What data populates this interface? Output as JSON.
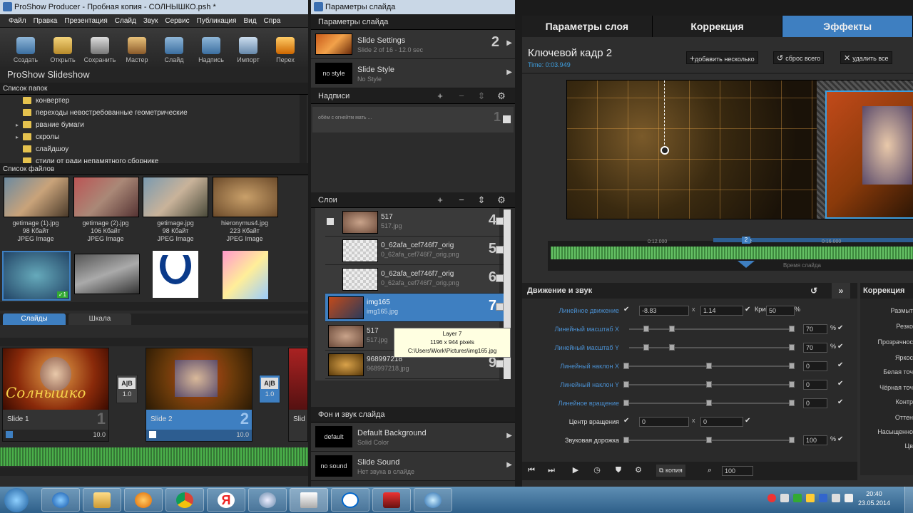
{
  "left_window": {
    "title": "ProShow Producer - Пробная копия - СОЛНЫШКО.psh *",
    "menu": [
      "Файл",
      "Правка",
      "Презентация",
      "Слайд",
      "Звук",
      "Сервис",
      "Публикация",
      "Вид",
      "Спра"
    ],
    "toolbar": [
      "Создать",
      "Открыть",
      "Сохранить",
      "Мастер",
      "Слайд",
      "Надпись",
      "Импорт",
      "Перех"
    ],
    "app_label": "ProShow Slideshow",
    "folders_title": "Список папок",
    "folders": [
      "конвертер",
      "переходы невостребованные  геометрические",
      "рвание бумаги",
      "скролы",
      "слайдшоу",
      "стили от ради непамятного сборнике"
    ],
    "files_title": "Список файлов",
    "files": [
      {
        "name": "getimage (1).jpg",
        "size": "98 Кбайт",
        "type": "JPEG Image"
      },
      {
        "name": "getimage (2).jpg",
        "size": "106 Кбайт",
        "type": "JPEG Image"
      },
      {
        "name": "getimage.jpg",
        "size": "98 Кбайт",
        "type": "JPEG Image"
      },
      {
        "name": "hieronymus4.jpg",
        "size": "223 Кбайт",
        "type": "JPEG Image"
      }
    ],
    "file_badge": "✓1",
    "tabs": [
      "Слайды",
      "Шкала"
    ],
    "slides": [
      {
        "label": "Slide 1",
        "num": "1",
        "dur": "10.0"
      },
      {
        "label": "Slide 2",
        "num": "2",
        "dur": "10.0"
      },
      {
        "label": "Slid",
        "num": "",
        "dur": ""
      }
    ],
    "transitions": [
      "1.0",
      "1.0"
    ],
    "slide1_caption": "Солнышко"
  },
  "mid_panel": {
    "title": "Параметры слайда",
    "header": "Параметры слайда",
    "slide_settings": {
      "t1": "Slide Settings",
      "t2": "Slide 2 of 16 - 12.0 sec",
      "num": "2"
    },
    "slide_style": {
      "thumb": "no style",
      "t1": "Slide Style",
      "t2": "No Style"
    },
    "captions_title": "Надписи",
    "caption_item": {
      "text": "обём с огнейтм мать ...",
      "num": "1"
    },
    "layers_title": "Слои",
    "layers": [
      {
        "n1": "517",
        "n2": "517.jpg",
        "num": "4"
      },
      {
        "n1": "0_62afa_cef746f7_orig",
        "n2": "0_62afa_cef746f7_orig.png",
        "num": "5"
      },
      {
        "n1": "0_62afa_cef746f7_orig",
        "n2": "0_62afa_cef746f7_orig.png",
        "num": "6"
      },
      {
        "n1": "img165",
        "n2": "img165.jpg",
        "num": "7"
      },
      {
        "n1": "517",
        "n2": "517.jpg",
        "num": "8"
      },
      {
        "n1": "968997218",
        "n2": "968997218.jpg",
        "num": "9"
      }
    ],
    "tooltip": {
      "l1": "Layer 7",
      "l2": "1196 x 944 pixels",
      "l3": "C:\\Users\\Work\\Pictures\\img165.jpg"
    },
    "bg_title": "Фон и звук слайда",
    "bg": {
      "thumb": "default",
      "t1": "Default Background",
      "t2": "Solid Color"
    },
    "sound": {
      "thumb": "no sound",
      "t1": "Slide Sound",
      "t2": "Нет звука в слайде"
    }
  },
  "right_window": {
    "tabs": [
      "Параметры слоя",
      "Коррекция",
      "Эффекты"
    ],
    "keyframe_title": "Ключевой кадр 2",
    "keyframe_time": "Time: 0:03.949",
    "btn_add": "добавить несколько",
    "btn_reset": "сброс всего",
    "btn_del": "удалить все",
    "ticks": [
      "0:12.000",
      "0:16.000",
      "0:2"
    ],
    "slide_time": "Время слайда",
    "kf_marker": "2",
    "motion_title": "Движение и звук",
    "curve_label": "Кривая",
    "curve_val": "50",
    "pct": "%",
    "rows": [
      {
        "label": "Линейное движение",
        "v1": "-8.83",
        "v2": "1.14"
      },
      {
        "label": "Линейный масштаб X",
        "v1": "70"
      },
      {
        "label": "Линейный масштаб Y",
        "v1": "70"
      },
      {
        "label": "Линейный наклон X",
        "v1": "0"
      },
      {
        "label": "Линейный наклон Y",
        "v1": "0"
      },
      {
        "label": "Линейное вращение",
        "v1": "0"
      },
      {
        "label": "Центр вращения",
        "v1": "0",
        "v2": "0"
      },
      {
        "label": "Звуковая дорожка",
        "v1": "100"
      }
    ],
    "correction_title": "Коррекция",
    "correction_items": [
      "Размыт",
      "Резко",
      "Прозрачнос",
      "Яркос",
      "Белая точ",
      "Чёрная точ",
      "Контр",
      "Оттен",
      "Насыщенно",
      "Цв"
    ],
    "bottom": {
      "copy": "копия",
      "zoom": "100"
    }
  },
  "taskbar": {
    "time": "20:40",
    "date": "23.05.2014"
  }
}
